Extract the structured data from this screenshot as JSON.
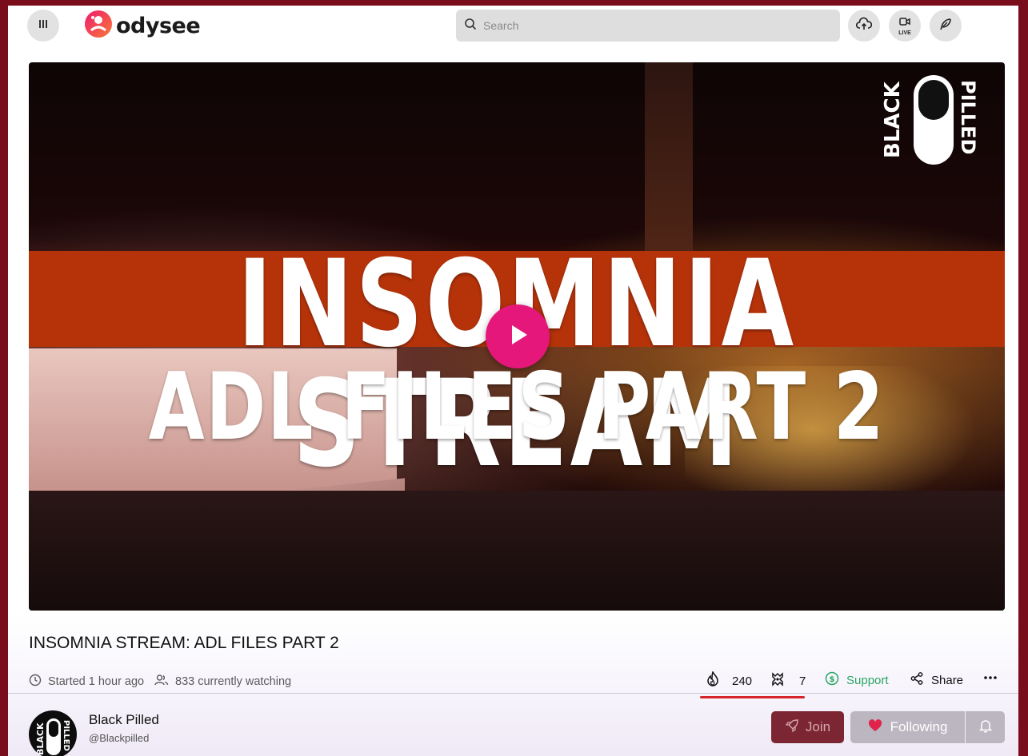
{
  "header": {
    "menu_icon": "menu-icon",
    "logo_text": "odysee",
    "search_placeholder": "Search",
    "upload_icon": "upload-cloud-icon",
    "live_label": "LIVE",
    "publish_icon": "feather-pen-icon"
  },
  "video": {
    "thumbnail_line1": "INSOMNIA STREAM",
    "thumbnail_line2": "ADL FILES PART 2",
    "badge_left": "BLACK",
    "badge_right": "PILLED",
    "play_icon": "play-icon"
  },
  "title": "INSOMNIA STREAM: ADL FILES PART 2",
  "meta": {
    "started": "Started 1 hour ago",
    "watching": "833 currently watching"
  },
  "actions": {
    "fire_count": "240",
    "slime_count": "7",
    "support_label": "Support",
    "share_label": "Share",
    "more_icon": "more-dots-icon"
  },
  "channel": {
    "name": "Black Pilled",
    "handle": "@Blackpilled",
    "avatar_left": "BLACK",
    "avatar_right": "PILLED",
    "join_label": "Join",
    "following_label": "Following",
    "bell_icon": "bell-icon"
  },
  "colors": {
    "brand_pink": "#e5177a",
    "support_green": "#2ba563",
    "fire_red": "#d6242a",
    "border_maroon": "#7a0d1c"
  }
}
